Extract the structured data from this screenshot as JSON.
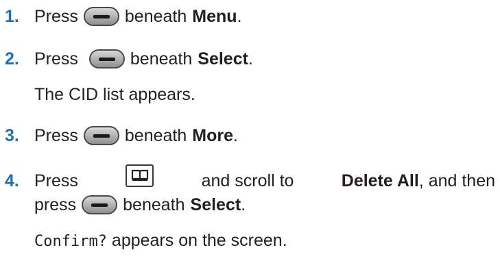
{
  "steps": [
    {
      "number": "1.",
      "press": "Press",
      "key_icon": "soft-key-icon",
      "beneath": "beneath",
      "target": "Menu",
      "end": "."
    },
    {
      "number": "2.",
      "press": "Press",
      "key_icon": "soft-key-icon",
      "beneath": "beneath",
      "target": "Select",
      "end": ".",
      "note": "The CID list appears."
    },
    {
      "number": "3.",
      "press": "Press",
      "key_icon": "soft-key-icon",
      "beneath": "beneath",
      "target": "More",
      "end": "."
    },
    {
      "number": "4.",
      "press": "Press",
      "key_icon": "phonebook-key-icon",
      "scroll_text": "and scroll to",
      "scroll_target": "Delete All",
      "then_text": ", and then",
      "line2_press": "press",
      "line2_key_icon": "soft-key-icon",
      "line2_beneath": "beneath",
      "line2_target": "Select",
      "line2_end": ".",
      "note_mono": "Confirm?",
      "note_rest": " appears on the screen."
    }
  ],
  "colors": {
    "step_number": "#1f6fb6",
    "text": "#231f20"
  }
}
